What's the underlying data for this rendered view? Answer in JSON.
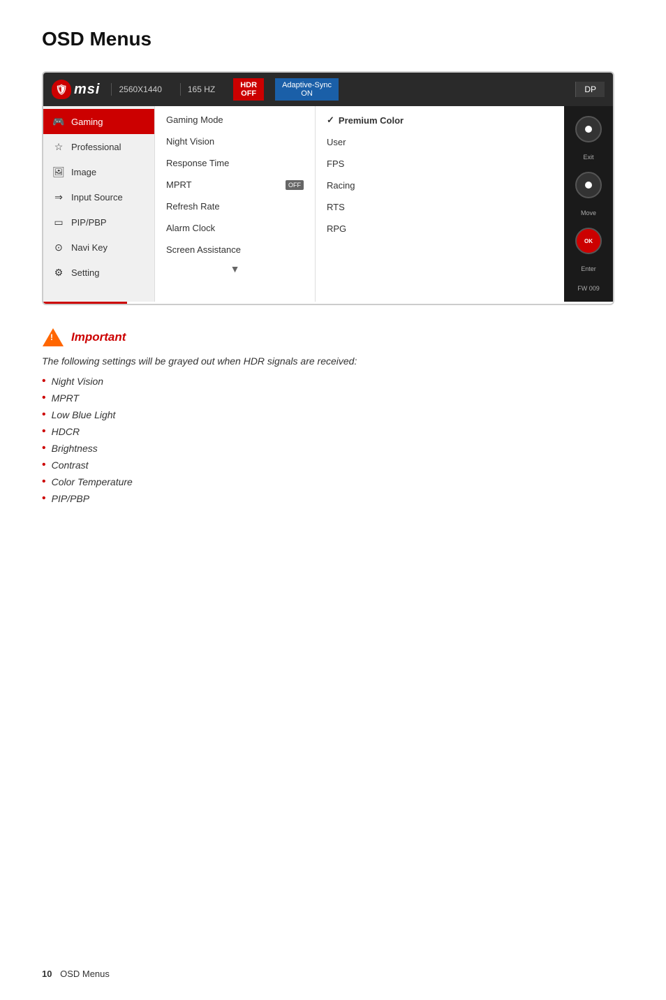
{
  "page": {
    "title": "OSD Menus",
    "footer_number": "10",
    "footer_label": "OSD Menus"
  },
  "topbar": {
    "resolution": "2560X1440",
    "hz": "165 HZ",
    "hdr_label": "HDR",
    "hdr_value": "OFF",
    "adaptive_label": "Adaptive-Sync",
    "adaptive_value": "ON",
    "dp": "DP"
  },
  "sidebar": {
    "items": [
      {
        "label": "Gaming",
        "icon": "🎮",
        "active": true
      },
      {
        "label": "Professional",
        "icon": "☆",
        "active": false
      },
      {
        "label": "Image",
        "icon": "🖼",
        "active": false
      },
      {
        "label": "Input Source",
        "icon": "⇒",
        "active": false
      },
      {
        "label": "PIP/PBP",
        "icon": "▭",
        "active": false
      },
      {
        "label": "Navi Key",
        "icon": "⊙",
        "active": false
      },
      {
        "label": "Setting",
        "icon": "⚙",
        "active": false
      }
    ]
  },
  "middle_panel": {
    "items": [
      {
        "label": "Gaming Mode",
        "badge": ""
      },
      {
        "label": "Night Vision",
        "badge": ""
      },
      {
        "label": "Response Time",
        "badge": ""
      },
      {
        "label": "MPRT",
        "badge": "OFF"
      },
      {
        "label": "Refresh Rate",
        "badge": ""
      },
      {
        "label": "Alarm Clock",
        "badge": ""
      },
      {
        "label": "Screen Assistance",
        "badge": ""
      }
    ]
  },
  "right_panel": {
    "items": [
      {
        "label": "Premium Color",
        "selected": true
      },
      {
        "label": "User",
        "selected": false
      },
      {
        "label": "FPS",
        "selected": false
      },
      {
        "label": "Racing",
        "selected": false
      },
      {
        "label": "RTS",
        "selected": false
      },
      {
        "label": "RPG",
        "selected": false
      }
    ]
  },
  "controls": {
    "exit_label": "Exit",
    "move_label": "Move",
    "enter_label": "Enter",
    "fw_label": "FW 009"
  },
  "important": {
    "title": "Important",
    "description": "The following settings will be grayed out when HDR signals are received:",
    "items": [
      "Night Vision",
      "MPRT",
      "Low Blue Light",
      "HDCR",
      "Brightness",
      "Contrast",
      "Color Temperature",
      "PIP/PBP"
    ]
  }
}
